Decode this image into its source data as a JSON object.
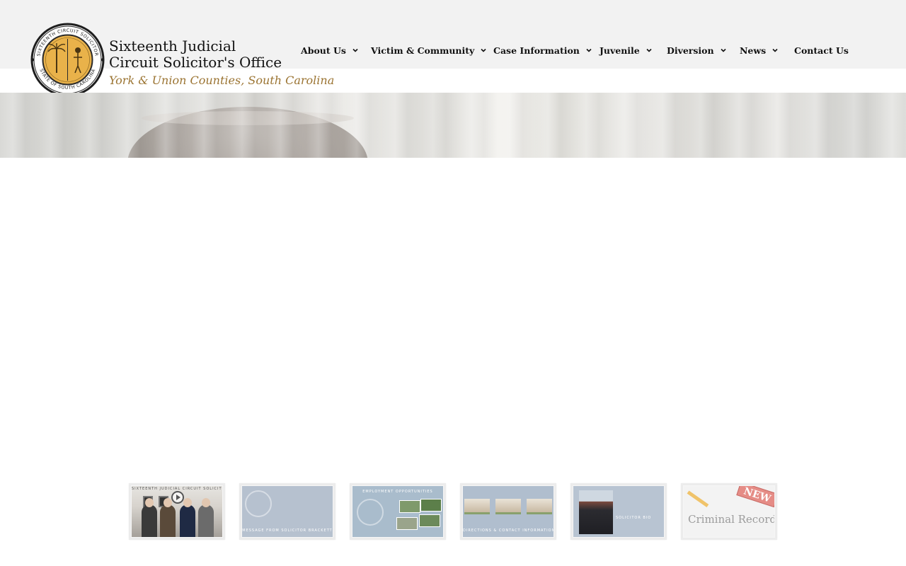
{
  "site": {
    "title_line1": "Sixteenth Judicial",
    "title_line2": "Circuit Solicitor's Office",
    "subtitle": "York & Union Counties, South Carolina",
    "seal_text_top": "SIXTEENTH CIRCUIT SOLICITOR",
    "seal_text_bottom": "STATE OF SOUTH CAROLINA"
  },
  "nav": {
    "items": [
      {
        "label": "About Us",
        "has_dropdown": true
      },
      {
        "label": "Victim & Community",
        "has_dropdown": true
      },
      {
        "label": "Case Information",
        "has_dropdown": true
      },
      {
        "label": "Juvenile",
        "has_dropdown": true
      },
      {
        "label": "Diversion",
        "has_dropdown": true
      },
      {
        "label": "News",
        "has_dropdown": true
      },
      {
        "label": "Contact Us",
        "has_dropdown": false
      }
    ]
  },
  "thumbnails": [
    {
      "caption": "Sixteenth Judicial Circuit Solicitor",
      "icon": "play-icon"
    },
    {
      "caption": "MESSAGE FROM SOLICITOR BRACKETT"
    },
    {
      "caption": "EMPLOYMENT OPPORTUNITIES"
    },
    {
      "caption": "DIRECTIONS & CONTACT INFORMATION"
    },
    {
      "caption": "SOLICITOR BIO"
    },
    {
      "caption": "Criminal Record",
      "badge": "NEW"
    }
  ],
  "colors": {
    "header_bg": "#f2f2f2",
    "subtitle": "#9b7432",
    "seal_gold": "#e9b24a",
    "nav_text": "#111111"
  }
}
